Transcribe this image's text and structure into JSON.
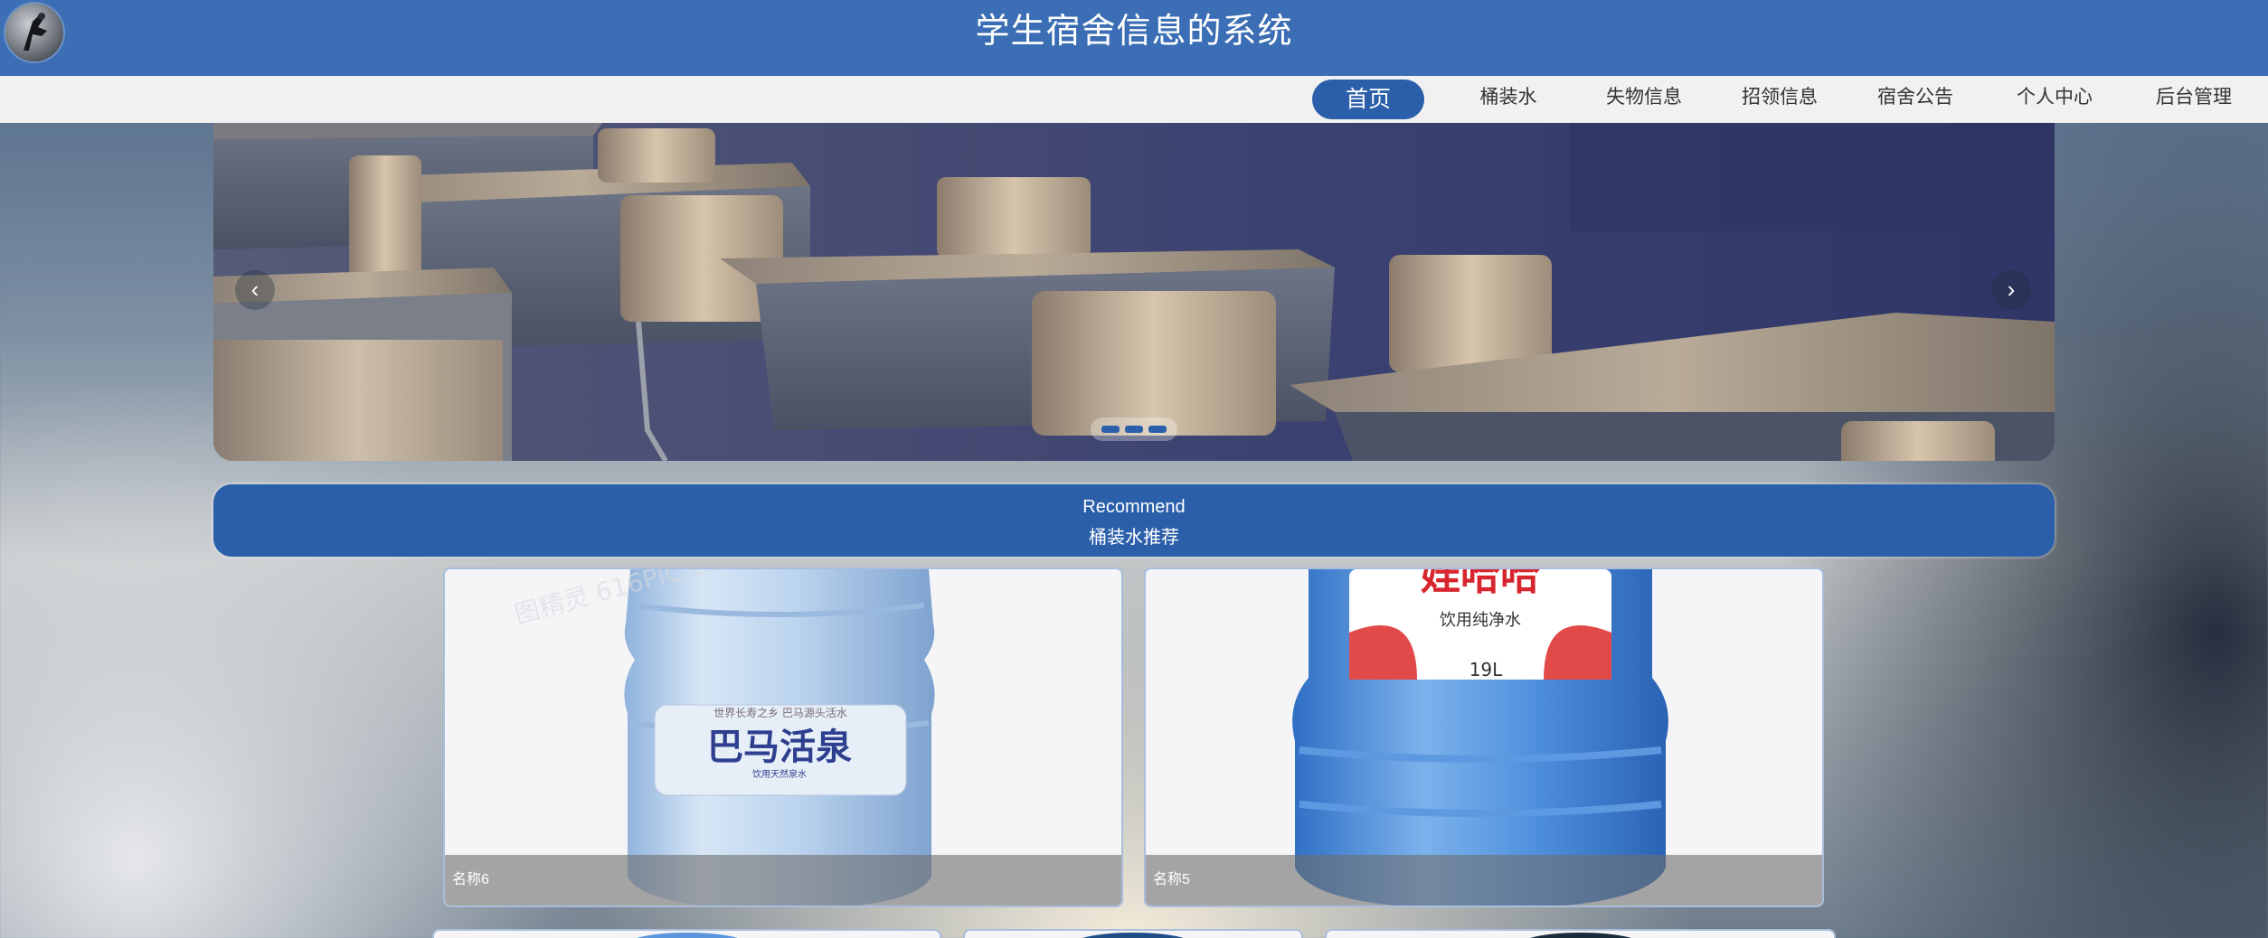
{
  "header": {
    "title": "学生宿舍信息的系统",
    "logo_icon": "user-avatar-icon",
    "bar_color": "#3b6eb4"
  },
  "nav": {
    "items": [
      {
        "label": "首页",
        "active": true
      },
      {
        "label": "桶装水",
        "active": false
      },
      {
        "label": "失物信息",
        "active": false
      },
      {
        "label": "招领信息",
        "active": false
      },
      {
        "label": "宿舍公告",
        "active": false
      },
      {
        "label": "个人中心",
        "active": false
      },
      {
        "label": "后台管理",
        "active": false
      }
    ],
    "active_color": "#2b5fa9"
  },
  "banner": {
    "prev_icon": "chevron-left-icon",
    "next_icon": "chevron-right-icon",
    "prev_glyph": "‹",
    "next_glyph": "›",
    "slide_count": 3
  },
  "recommend": {
    "title_en": "Recommend",
    "title_cn": "桶装水推荐"
  },
  "products": [
    {
      "name": "名称6",
      "brand": "巴马活泉",
      "tagline": "世界长寿之乡 巴马源头活水",
      "sub": "饮用天然泉水"
    },
    {
      "name": "名称5",
      "brand": "娃哈哈",
      "tagline": "饮用纯净水",
      "volume": "19L"
    }
  ]
}
